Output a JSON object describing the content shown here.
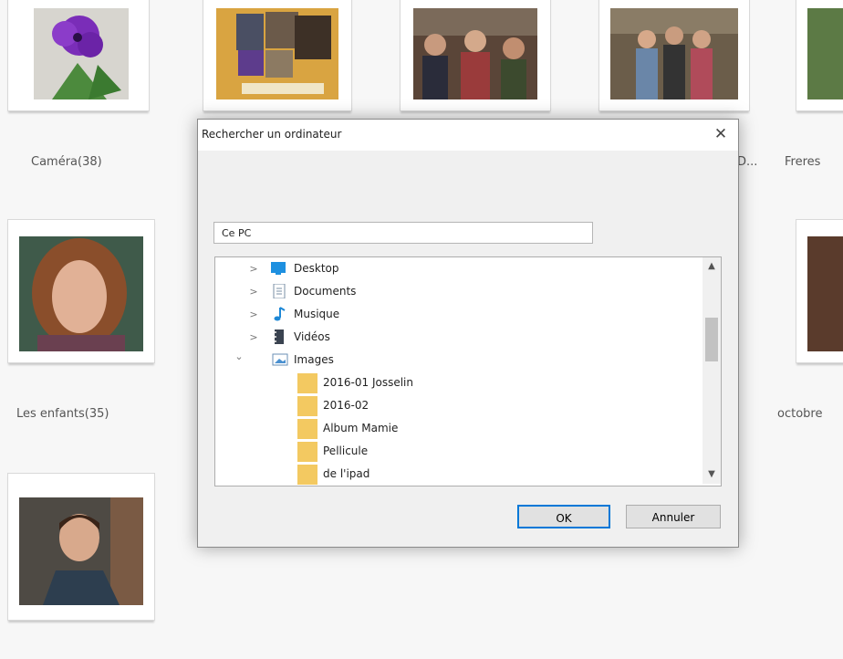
{
  "albums": [
    {
      "caption": "Caméra(38)"
    },
    {
      "caption": ""
    },
    {
      "caption": ""
    },
    {
      "caption": "D..."
    },
    {
      "caption": "Freres"
    },
    {
      "caption": "Les enfants(35)"
    },
    {
      "caption": "octobre"
    },
    {
      "caption": ""
    }
  ],
  "dialog": {
    "title": "Rechercher un ordinateur",
    "close_glyph": "✕",
    "path_value": "Ce PC",
    "tree": [
      {
        "label": "Desktop",
        "chevron": ">",
        "icon": "desktop-icon"
      },
      {
        "label": "Documents",
        "chevron": ">",
        "icon": "documents-icon"
      },
      {
        "label": "Musique",
        "chevron": ">",
        "icon": "music-icon"
      },
      {
        "label": "Vidéos",
        "chevron": ">",
        "icon": "video-icon"
      },
      {
        "label": "Images",
        "chevron": "⌄",
        "icon": "pictures-icon"
      },
      {
        "label": "2016-01 Josselin",
        "icon": "folder-icon"
      },
      {
        "label": "2016-02",
        "icon": "folder-icon"
      },
      {
        "label": "Album Mamie",
        "icon": "folder-icon"
      },
      {
        "label": "Pellicule",
        "icon": "folder-icon"
      },
      {
        "label": "de l'ipad",
        "icon": "folder-icon"
      }
    ],
    "scroll_up_glyph": "▲",
    "scroll_down_glyph": "▼",
    "ok_label": "OK",
    "cancel_label": "Annuler"
  },
  "colors": {
    "accent": "#0078d7",
    "folder": "#f3c961"
  }
}
